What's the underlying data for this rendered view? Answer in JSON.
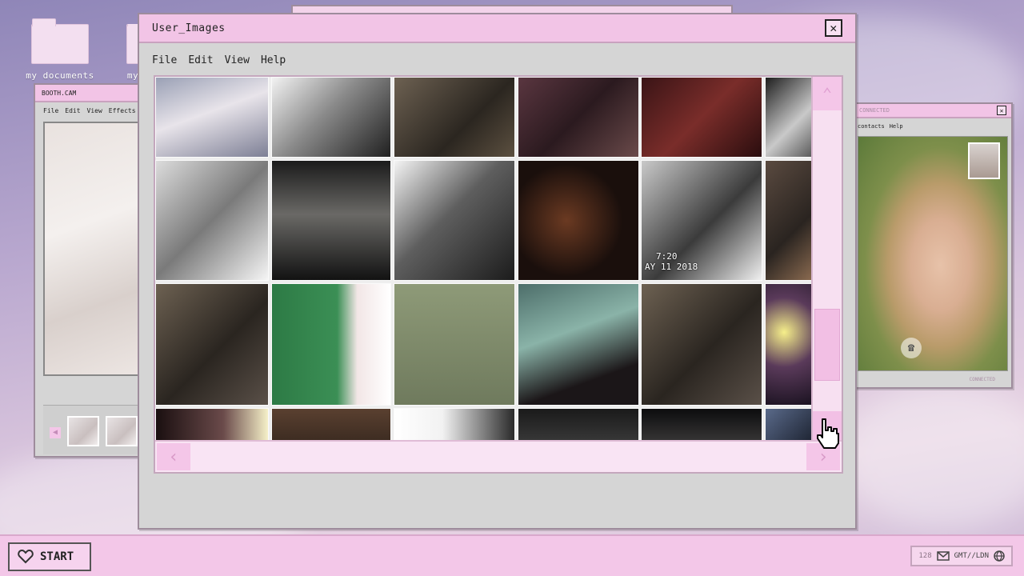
{
  "desktop": {
    "icons": [
      {
        "label": "my documents",
        "icon": "folder-icon"
      },
      {
        "label": "my",
        "icon": "folder-icon"
      }
    ]
  },
  "booth_window": {
    "title": "BOOTH.CAM",
    "menu": [
      "File",
      "Edit",
      "View",
      "Effects"
    ]
  },
  "connected_window": {
    "title": "CONNECTED",
    "menu": [
      "contacts",
      "Help"
    ],
    "status": "CONNECTED"
  },
  "main_window": {
    "title": "User_Images",
    "menu": [
      "File",
      "Edit",
      "View",
      "Help"
    ],
    "cells": [
      {
        "bg": "linear-gradient(160deg,#9aa0b5,#e8e4ea 45%,#7d7f95)"
      },
      {
        "bg": "linear-gradient(135deg,#f2f2f2,#8a8a8a 45%,#202020)"
      },
      {
        "bg": "linear-gradient(135deg,#6d6152,#2b2620 60%,#5c5040)"
      },
      {
        "bg": "linear-gradient(135deg,#5a3640,#2b1a1f 50%,#6a4a4a)"
      },
      {
        "bg": "linear-gradient(135deg,#3a1416,#7a2d2a 50%,#2a0d0e)"
      },
      {
        "bg": "linear-gradient(135deg,#1e1e1e,#c9c9c9 60%,#5a5a5a)"
      },
      {
        "bg": "linear-gradient(135deg,#dcdcdc,#7a7a7a 50%,#f5f5f5)"
      },
      {
        "bg": "linear-gradient(180deg,#1b1b1b,#6a6966 45%,#121212)"
      },
      {
        "bg": "linear-gradient(135deg,#f4f4f4,#5e5e5e 45%,#1c1c1c)"
      },
      {
        "bg": "radial-gradient(circle at 40% 50%,#6b3a22,#1a0f0c 60%)"
      },
      {
        "bg": "linear-gradient(135deg,#c9c9c9,#3b3b3b 55%,#f0f0f0)"
      },
      {
        "bg": "linear-gradient(135deg,#5a4a40,#2a2420 60%,#8a6a50)"
      },
      {
        "bg": "linear-gradient(135deg,#6d6152,#2a2520 55%,#5a5048)"
      },
      {
        "bg": "linear-gradient(90deg,#2d7a45,#3b8f55 55%,#f2e6e6 72%,#ffffff)"
      },
      {
        "bg": "linear-gradient(180deg,#8e9a78,#6f7a5d)"
      },
      {
        "bg": "linear-gradient(160deg,#4d6e6a,#8ab3a8 40%,#1b1618 75%)"
      },
      {
        "bg": "linear-gradient(135deg,#6d6152,#2a2520 55%,#5a5048)"
      },
      {
        "bg": "radial-gradient(circle at 40% 40%,#f6ef8a,#5a3a5a 45%,#1a1220)"
      },
      {
        "bg": "linear-gradient(90deg,#1a0f10,#6a4a4a 60%,#f5f0c8)"
      },
      {
        "bg": "linear-gradient(180deg,#5a4030,#3a2a20)"
      },
      {
        "bg": "linear-gradient(90deg,#ffffff,#f2f2f2 40%,#2a2a2a)"
      },
      {
        "bg": "linear-gradient(180deg,#1a1a1a,#3a3a3a)"
      },
      {
        "bg": "linear-gradient(180deg,#0c0c0e,#3a3838)"
      },
      {
        "bg": "linear-gradient(135deg,#5a6a8a,#1c2230)"
      }
    ],
    "overlay_text": {
      "time": "7:20",
      "date": "AY 11 2018"
    }
  },
  "taskbar": {
    "start_label": "START",
    "tray_count": "128",
    "tray_timezone": "GMT//LDN"
  },
  "colors": {
    "accent": "#f2c4e6",
    "frame": "#d5d5d5"
  }
}
